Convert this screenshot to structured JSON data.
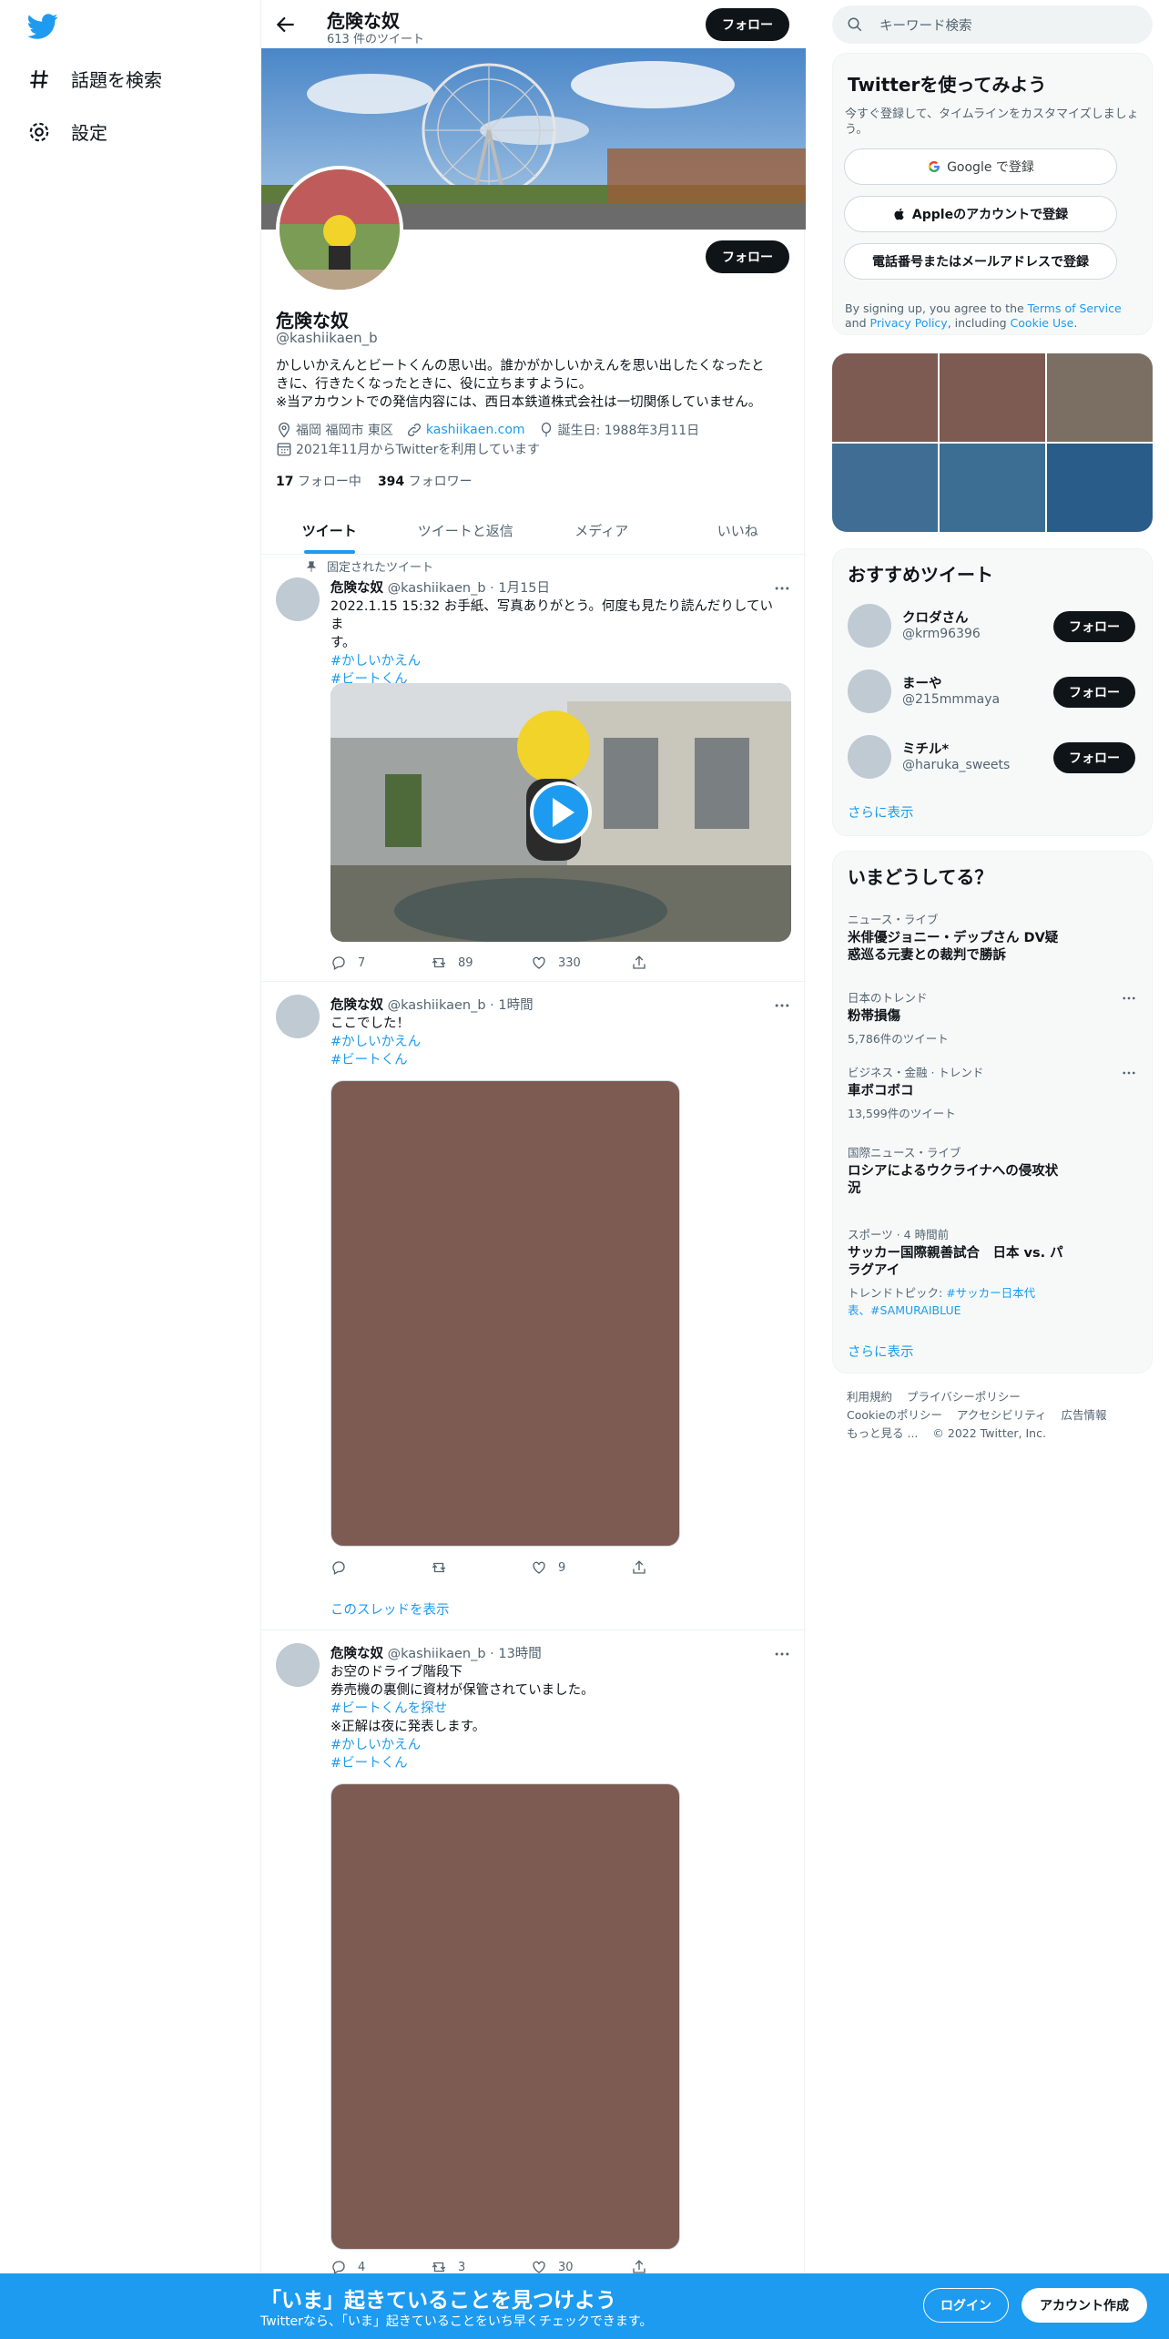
{
  "nav": {
    "explore": "話題を検索",
    "settings": "設定"
  },
  "profile": {
    "name": "危険な奴",
    "tweet_count": "613 件のツイート",
    "follow_label": "フォロー",
    "handle": "@kashiikaen_b",
    "bio_line1": "かしいかえんとビートくんの思い出。誰かがかしいかえんを思い出したくなったと",
    "bio_line2": "きに、行きたくなったときに、役に立ちますように。",
    "bio_line3": "※当アカウントでの発信内容には、西日本鉄道株式会社は一切関係していません。",
    "location": "福岡 福岡市 東区",
    "website": "kashiikaen.com",
    "birthday": "誕生日: 1988年3月11日",
    "joined": "2021年11月からTwitterを利用しています",
    "following_count": "17",
    "following_label": "フォロー中",
    "followers_count": "394",
    "followers_label": "フォロワー"
  },
  "tabs": [
    "ツイート",
    "ツイートと返信",
    "メディア",
    "いいね"
  ],
  "pinned_label": "固定されたツイート",
  "tweets": [
    {
      "name": "危険な奴",
      "handle": "@kashiikaen_b",
      "time": "· 1月15日",
      "line1": "2022.1.15 15:32 お手紙、写真ありがとう。何度も見たり読んだりしていま",
      "line2": "す。",
      "tags": [
        "#かしいかえん",
        "#ビートくん"
      ],
      "replies": "7",
      "retweets": "89",
      "likes": "330"
    },
    {
      "name": "危険な奴",
      "handle": "@kashiikaen_b",
      "time": "· 1時間",
      "line1": "ここでした！",
      "tags": [
        "#かしいかえん",
        "#ビートくん"
      ],
      "replies": "",
      "retweets": "",
      "likes": "9",
      "thread_link": "このスレッドを表示"
    },
    {
      "name": "危険な奴",
      "handle": "@kashiikaen_b",
      "time": "· 13時間",
      "line1": "お空のドライブ階段下",
      "line2": "券売機の裏側に資材が保管されていました。",
      "tag_inline": "#ビートくんを探せ",
      "line3": "※正解は夜に発表します。",
      "tags": [
        "#かしいかえん",
        "#ビートくん"
      ],
      "replies": "4",
      "retweets": "3",
      "likes": "30"
    }
  ],
  "search": {
    "placeholder": "キーワード検索"
  },
  "signup": {
    "title": "Twitterを使ってみよう",
    "subtitle": "今すぐ登録して、タイムラインをカスタマイズしましょう。",
    "google": "Google で登録",
    "apple": "Appleのアカウントで登録",
    "phone": "電話番号またはメールアドレスで登録",
    "terms_pre": "By signing up, you agree to the ",
    "terms_link": "Terms of Service",
    "terms_and": " and ",
    "privacy_link": "Privacy Policy",
    "terms_incl": ", including ",
    "cookie_link": "Cookie Use",
    "terms_end": "."
  },
  "recommend": {
    "title": "おすすめツイート",
    "users": [
      {
        "name": "クロダさん",
        "handle": "@krm96396"
      },
      {
        "name": "まーや",
        "handle": "@215mmmaya"
      },
      {
        "name": "ミチル*",
        "handle": "@haruka_sweets"
      }
    ],
    "follow_label": "フォロー",
    "show_more": "さらに表示"
  },
  "trends": {
    "title": "いまどうしてる？",
    "items": [
      {
        "context": "ニュース・ライブ",
        "title": "米俳優ジョニー・デップさん DV疑惑巡る元妻との裁判で勝訴",
        "count": ""
      },
      {
        "context": "日本のトレンド",
        "title": "粉帯損傷",
        "count": "5,786件のツイート"
      },
      {
        "context": "ビジネス・金融 · トレンド",
        "title": "車ボコボコ",
        "count": "13,599件のツイート"
      },
      {
        "context": "国際ニュース・ライブ",
        "title": "ロシアによるウクライナへの侵攻状況",
        "count": ""
      },
      {
        "context": "スポーツ · 4 時間前",
        "title": "サッカー国際親善試合　日本 vs. パラグアイ",
        "topic_label": "トレンドトピック: ",
        "topic_tags": "#サッカー日本代表、#SAMURAIBLUE"
      }
    ],
    "show_more": "さらに表示"
  },
  "footer": {
    "links": [
      "利用規約",
      "プライバシーポリシー",
      "Cookieのポリシー",
      "アクセシビリティ",
      "広告情報",
      "もっと見る ..."
    ],
    "copyright": "© 2022 Twitter, Inc."
  },
  "bottom_bar": {
    "title": "「いま」起きていることを見つけよう",
    "subtitle": "Twitterなら、「いま」起きていることをいち早くチェックできます。",
    "login": "ログイン",
    "signup": "アカウント作成"
  },
  "colors": {
    "accent": "#1d9bf0",
    "bottom_bar": "#1d9bf0",
    "media_placeholder": "#7d5a52"
  }
}
